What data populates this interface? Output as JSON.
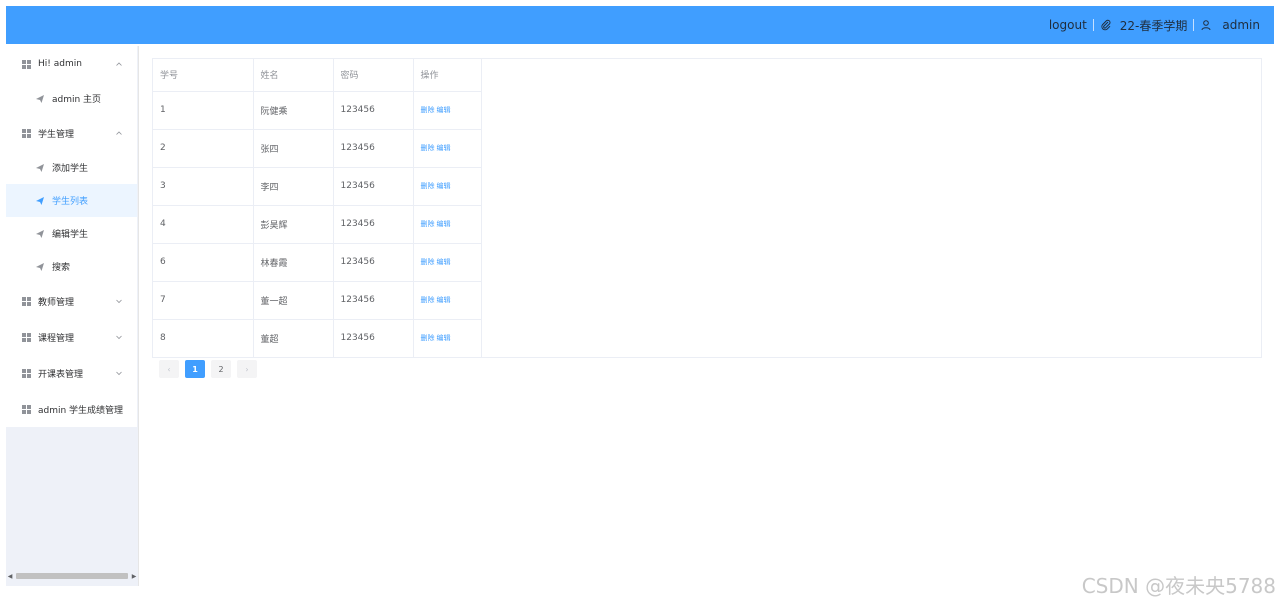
{
  "header": {
    "logout": "logout",
    "semester": "22-春季学期",
    "username": "admin",
    "accent": "#409eff"
  },
  "sidebar": {
    "items": [
      {
        "label": "Hi! admin",
        "type": "group",
        "expanded": true
      },
      {
        "label": "admin 主页",
        "type": "sub"
      },
      {
        "label": "学生管理",
        "type": "group",
        "expanded": true
      },
      {
        "label": "添加学生",
        "type": "sub"
      },
      {
        "label": "学生列表",
        "type": "sub",
        "active": true
      },
      {
        "label": "编辑学生",
        "type": "sub"
      },
      {
        "label": "搜索",
        "type": "sub"
      },
      {
        "label": "教师管理",
        "type": "group",
        "expanded": false
      },
      {
        "label": "课程管理",
        "type": "group",
        "expanded": false
      },
      {
        "label": "开课表管理",
        "type": "group",
        "expanded": false
      },
      {
        "label": "admin 学生成绩管理",
        "type": "group"
      }
    ]
  },
  "table": {
    "columns": [
      "学号",
      "姓名",
      "密码",
      "操作"
    ],
    "delete_label": "删除",
    "edit_label": "编辑",
    "rows": [
      {
        "id": "1",
        "name": "阮健乘",
        "password": "123456"
      },
      {
        "id": "2",
        "name": "张四",
        "password": "123456"
      },
      {
        "id": "3",
        "name": "李四",
        "password": "123456"
      },
      {
        "id": "4",
        "name": "彭昊辉",
        "password": "123456"
      },
      {
        "id": "6",
        "name": "林春霞",
        "password": "123456"
      },
      {
        "id": "7",
        "name": "董一超",
        "password": "123456"
      },
      {
        "id": "8",
        "name": "董超",
        "password": "123456"
      }
    ]
  },
  "pagination": {
    "prev": "‹",
    "next": "›",
    "pages": [
      "1",
      "2"
    ],
    "current": "1"
  },
  "watermark": "CSDN @夜未央5788"
}
